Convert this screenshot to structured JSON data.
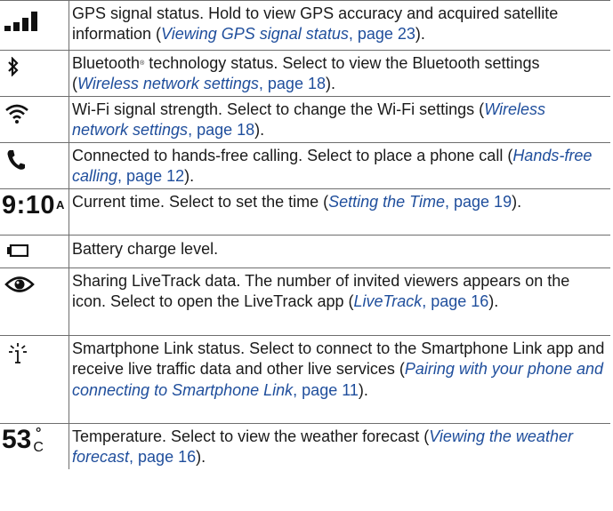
{
  "rows": [
    {
      "icon": "gps-signal-bars-icon",
      "text": "GPS signal status. Hold to view GPS accuracy and acquired satellite information (",
      "ref": "Viewing GPS signal status",
      "page": ", page 23",
      "tail": ")."
    },
    {
      "icon": "bluetooth-icon",
      "text_a": "Bluetooth",
      "reg": "®",
      "text_b": " technology status. Select to view the Bluetooth settings (",
      "ref": "Wireless network settings",
      "page": ", page 18",
      "tail": ")."
    },
    {
      "icon": "wifi-icon",
      "text": "Wi-Fi signal strength. Select to change the Wi-Fi settings (",
      "ref": "Wireless network settings",
      "page": ", page 18",
      "tail": ")."
    },
    {
      "icon": "phone-icon",
      "text": "Connected to hands-free calling. Select to place a phone call (",
      "ref": "Hands-free calling",
      "page": ", page 12",
      "tail": ")."
    },
    {
      "icon": "clock-time-icon",
      "glyph": "9:10",
      "glyph_suffix": "A",
      "text": "Current time. Select to set the time (",
      "ref": "Setting the Time",
      "page": ", page 19",
      "tail": ")."
    },
    {
      "icon": "battery-icon",
      "text": "Battery charge level."
    },
    {
      "icon": "eye-livetrack-icon",
      "text": "Sharing LiveTrack data. The number of invited viewers appears on the icon. Select to open the LiveTrack app (",
      "ref": "LiveTrack",
      "page": ", page 16",
      "tail": ")."
    },
    {
      "icon": "smartphone-link-icon",
      "text": "Smartphone Link status. Select to connect to the Smartphone Link app and receive live traffic data and other live services (",
      "ref": "Pairing with your phone and connecting to Smartphone Link",
      "page": ", page 11",
      "tail": ")."
    },
    {
      "icon": "temperature-icon",
      "glyph": "53",
      "glyph_suffix": "°",
      "glyph_unit": "C",
      "text": "Temperature. Select to view the weather forecast (",
      "ref": "Viewing the weather forecast",
      "page": ", page 16",
      "tail": ")."
    }
  ]
}
